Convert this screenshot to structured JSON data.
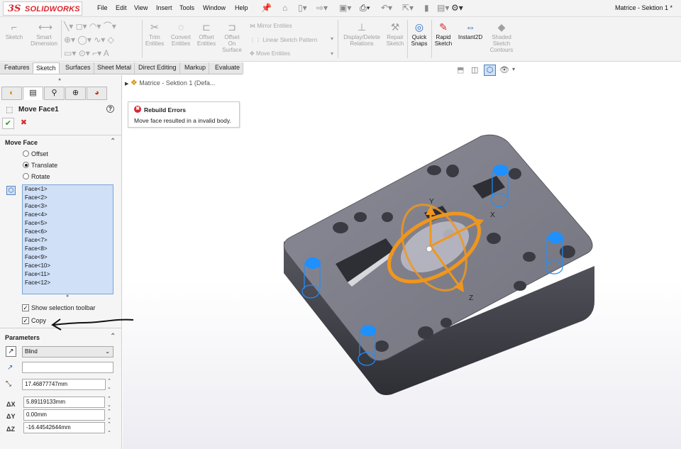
{
  "app": {
    "logo_prefix": "3S",
    "logo_text": "SOLIDWORKS",
    "document_title": "Matrice - Sektion 1 *"
  },
  "menu": [
    "File",
    "Edit",
    "View",
    "Insert",
    "Tools",
    "Window",
    "Help"
  ],
  "commands": {
    "sketch": "Sketch",
    "smart_dimension": "Smart Dimension",
    "trim": "Trim Entities",
    "convert": "Convert Entities",
    "offset": "Offset Entities",
    "offset_surface": "Offset On Surface",
    "mirror": "Mirror Entities",
    "linear_pattern": "Linear Sketch Pattern",
    "move": "Move Entities",
    "display_delete": "Display/Delete Relations",
    "repair": "Repair Sketch",
    "quick_snaps": "Quick Snaps",
    "rapid_sketch": "Rapid Sketch",
    "instant2d": "Instant2D",
    "shaded_contours": "Shaded Sketch Contours"
  },
  "tabs": [
    "Features",
    "Sketch",
    "Surfaces",
    "Sheet Metal",
    "Direct Editing",
    "Markup",
    "Evaluate"
  ],
  "property_manager": {
    "title": "Move Face1",
    "help": "?",
    "ok": "✔",
    "cancel": "✖",
    "move_face_header": "Move Face",
    "options": [
      "Offset",
      "Translate",
      "Rotate"
    ],
    "selected_option": "Translate",
    "faces": [
      "Face<1>",
      "Face<2>",
      "Face<3>",
      "Face<4>",
      "Face<5>",
      "Face<6>",
      "Face<7>",
      "Face<8>",
      "Face<9>",
      "Face<10>",
      "Face<11>",
      "Face<12>"
    ],
    "show_toolbar": "Show selection toolbar",
    "copy": "Copy",
    "parameters_header": "Parameters",
    "end_condition": "Blind",
    "direction_value": "",
    "distance": "17.46877747mm",
    "dx_label": "ΔX",
    "dy_label": "ΔY",
    "dz_label": "ΔZ",
    "dx": "5.89119133mm",
    "dy": "0.00mm",
    "dz": "-16.44542644mm"
  },
  "feature_tree": {
    "root": "Matrice - Sektion 1  (Defa..."
  },
  "error": {
    "title": "Rebuild Errors",
    "message": "Move face resulted in a invalid body."
  },
  "triad": {
    "x": "X",
    "y": "Y",
    "z": "Z"
  },
  "colors": {
    "accent_orange": "#f0961e",
    "brand_red": "#d7282f",
    "selection_blue": "#cfe0f7",
    "part_gray": "#6e6e78"
  }
}
